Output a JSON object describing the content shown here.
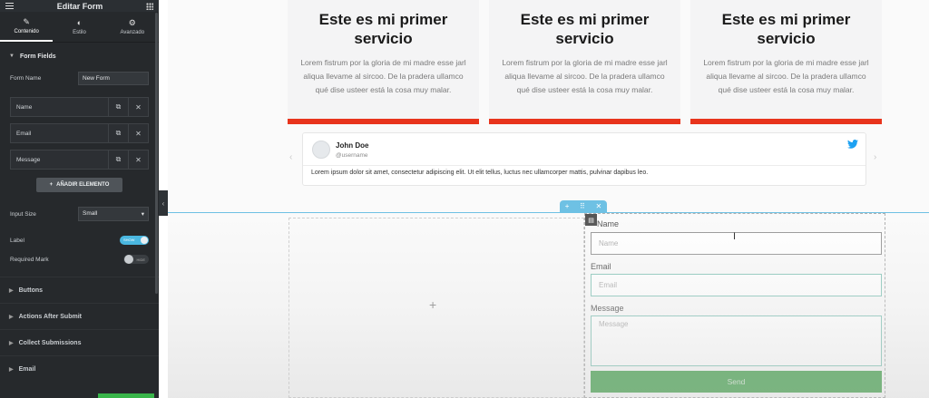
{
  "sidebar": {
    "title": "Editar Form",
    "tabs": [
      {
        "label": "Contenido",
        "icon": "pencil-icon"
      },
      {
        "label": "Estilo",
        "icon": "contrast-icon"
      },
      {
        "label": "Avanzado",
        "icon": "gear-icon"
      }
    ],
    "form_fields_section": "Form Fields",
    "form_name_label": "Form Name",
    "form_name_value": "New Form",
    "fields": [
      {
        "name": "Name"
      },
      {
        "name": "Email"
      },
      {
        "name": "Message"
      }
    ],
    "add_item_label": "AÑADIR ELEMENTO",
    "input_size_label": "Input Size",
    "input_size_value": "Small",
    "label_label": "Label",
    "label_toggle_text": "SHOW",
    "required_mark_label": "Required Mark",
    "required_toggle_text": "HIDE",
    "collapsed_sections": [
      "Buttons",
      "Actions After Submit",
      "Collect Submissions",
      "Email"
    ]
  },
  "services": [
    {
      "title": "Este es mi primer servicio",
      "text": "Lorem fistrum por la gloria de mi madre esse jarl aliqua llevame al sircoo. De la pradera ullamco qué dise usteer está la cosa muy malar."
    },
    {
      "title": "Este es mi primer servicio",
      "text": "Lorem fistrum por la gloria de mi madre esse jarl aliqua llevame al sircoo. De la pradera ullamco qué dise usteer está la cosa muy malar."
    },
    {
      "title": "Este es mi primer servicio",
      "text": "Lorem fistrum por la gloria de mi madre esse jarl aliqua llevame al sircoo. De la pradera ullamco qué dise usteer está la cosa muy malar."
    }
  ],
  "tweet": {
    "name": "John Doe",
    "handle": "@username",
    "body": "Lorem ipsum dolor sit amet, consectetur adipiscing elit. Ut elit tellus, luctus nec ullamcorper mattis, pulvinar dapibus leo."
  },
  "form": {
    "name_label": "Name",
    "name_placeholder": "Name",
    "email_label": "Email",
    "email_placeholder": "Email",
    "message_label": "Message",
    "message_placeholder": "Message",
    "send_label": "Send"
  },
  "colors": {
    "accent_red": "#e8341c",
    "section_blue": "#6ec1e4",
    "send_green": "#52a85a"
  }
}
